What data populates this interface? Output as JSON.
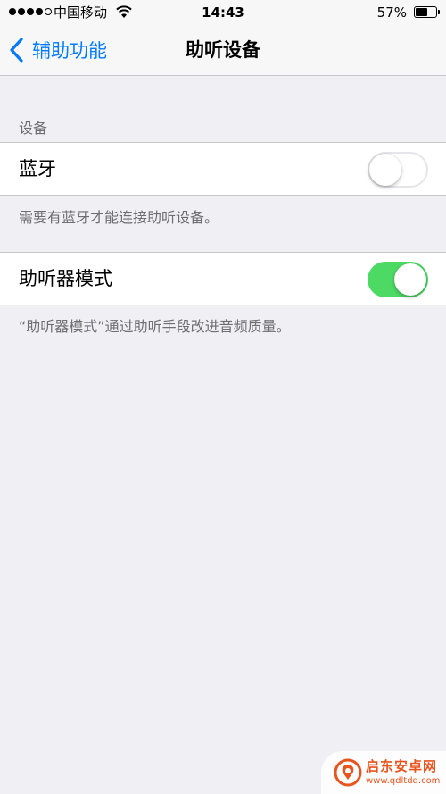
{
  "status_bar": {
    "carrier": "中国移动",
    "time": "14:43",
    "battery_percent": "57%",
    "battery_level": 0.57
  },
  "nav": {
    "back_label": "辅助功能",
    "title": "助听设备"
  },
  "sections": {
    "devices_header": "设备",
    "bluetooth_label": "蓝牙",
    "bluetooth_on": false,
    "bluetooth_footer": "需要有蓝牙才能连接助听设备。",
    "hearing_aid_mode_label": "助听器模式",
    "hearing_aid_mode_on": true,
    "hearing_aid_mode_footer": "“助听器模式”通过助听手段改进音频质量。"
  },
  "watermark": {
    "name": "启东安卓网",
    "url": "www.qdltdq.com"
  },
  "colors": {
    "ios_blue": "#007aff",
    "toggle_green": "#4cd964",
    "background": "#efeff4",
    "footer_gray": "#6d6d72",
    "watermark_orange": "#e8541d"
  },
  "icons": {
    "signal": "signal-dots-icon",
    "wifi": "wifi-icon",
    "battery": "battery-icon",
    "back": "chevron-left-icon",
    "watermark_logo": "qidong-logo-icon"
  }
}
